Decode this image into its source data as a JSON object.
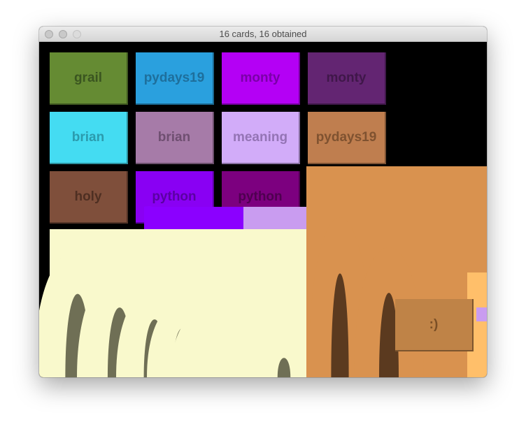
{
  "window": {
    "title": "16 cards, 16 obtained"
  },
  "cards": [
    {
      "label": "grail",
      "bg": "#658b33",
      "fg": "#3a5520"
    },
    {
      "label": "pydays19",
      "bg": "#2aa0de",
      "fg": "#1e6f9c"
    },
    {
      "label": "monty",
      "bg": "#b400f5",
      "fg": "#7a00a8"
    },
    {
      "label": "monty",
      "bg": "#632572",
      "fg": "#3f1749"
    },
    {
      "label": "brian",
      "bg": "#44dcf2",
      "fg": "#2b9bad"
    },
    {
      "label": "brian",
      "bg": "#a67ba8",
      "fg": "#6f4f71"
    },
    {
      "label": "meaning",
      "bg": "#d2acf9",
      "fg": "#9474b5"
    },
    {
      "label": "pydays19",
      "bg": "#bf7e4f",
      "fg": "#7f5230"
    },
    {
      "label": "holy",
      "bg": "#7f4f3b",
      "fg": "#4e2f22"
    },
    {
      "label": "python",
      "bg": "#8900f3",
      "fg": "#5b00a3"
    },
    {
      "label": "python",
      "bg": "#7c007f",
      "fg": "#4e0050"
    }
  ],
  "final_card": {
    "label": ":)",
    "bg": "#bf8347",
    "fg": "#7a4f26"
  },
  "colors": {
    "cream": "#f9f9cc",
    "cream_shadow": "#6f6f55",
    "purple": "#8b00ff",
    "lilac": "#c99cf0",
    "orange": "#d9924f",
    "orange_shadow": "#5b3a1f",
    "gold": "#ffbf6a"
  }
}
